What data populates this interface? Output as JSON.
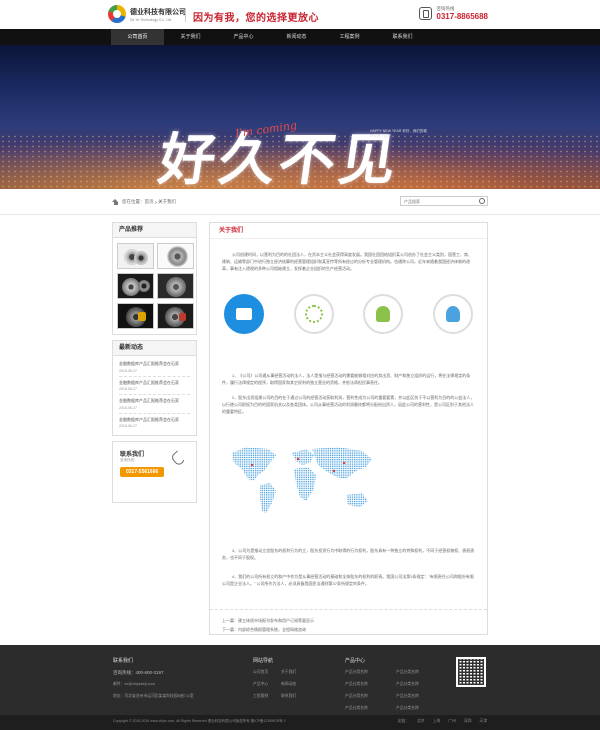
{
  "header": {
    "company_cn": "德业科技有限公司",
    "company_en": "De Ye Technology Co., Ltd.",
    "slogan": "因为有我，您的选择更放心",
    "phone_label": "咨询热线",
    "phone_number": "0317-8865688"
  },
  "nav": {
    "items": [
      "公司首页",
      "关于我们",
      "产品中心",
      "新闻动态",
      "工程案例",
      "联系我们"
    ],
    "active_index": 0
  },
  "banner": {
    "calligraphy": "好久不见",
    "script": "I'm coming",
    "small_text": "HAPPY NEW YEAR 你好，我们的城市又亮了起来"
  },
  "breadcrumb": {
    "prefix": "您在位置：",
    "home": "首页",
    "sep": ">",
    "current": "关于我们"
  },
  "search": {
    "placeholder": "产品搜索"
  },
  "sidebar": {
    "products_title": "产品推荐",
    "news_title": "最新动态",
    "news": [
      {
        "title": "金融数据库产品汇报推荐会在石家",
        "date": "2018-06-27"
      },
      {
        "title": "金融数据库产品汇报推荐会在石家",
        "date": "2018-06-27"
      },
      {
        "title": "金融数据库产品汇报推荐会在石家",
        "date": "2018-06-27"
      },
      {
        "title": "金融数据库产品汇报推荐会在石家",
        "date": "2018-06-27"
      }
    ],
    "contact_title": "联系我们",
    "contact_sub": "咨询热线：",
    "contact_phone": "0317-5561666"
  },
  "content": {
    "title": "关于我们",
    "p1": "公司创建时间，以营利为目的的社团法人，在资本主义社会获得高度发展。我国社团团结组织某公司创办了社会主义类别，国营工、商、建筑、运输等部门中进行独立经济核算的经营管理组织和某宣传等所有经过的分析专业管理机构。也通称公司，近年来随着我国经济体制的改革，事有注入透视的多种公司相继建立，发挥着企业组织的生产经营活动。",
    "p2": "1、《公司》公司通从事经营活动的法人，法人是指与经营活动的需要能够相对应的其出资、财产和独立组织的运行，将在法律规定的条件，履行法律规定的程序，取得国家和其它权利的独立营业的资格，并依法承担民事责任。",
    "p3": "2、股东出资组建公司的目的在于通过公司的经营活动获取利润，营利性成为公司的重要要素，并以此区别于不以营利为目的的公益法人，以行使公司职权为目的的国家机关以及各类团体。公司从事经营活动的利润最终都将分配给出资人，因此公司的营利性，是公司区别于其他法人的重要特征。",
    "p4": "3、公司为是推动立信股东的权利行为的立，股东投资行为中取得的行为权利，股东具有一种独立的特殊权利，不同于经营权物权、债权债务，也不同于股权。",
    "p5": "4、我们的公司所有权立的和产中作为是从事经营活动的基础和全体股东的权利的职责。我国公司法第3条规定：\"有限责任公司和股份有限公司是企业法人。\" 公司所作为法人，必须具备我国民法通则第37条所规定的条件。",
    "prev_label": "上一篇：",
    "prev_title": "建立体质市场报刊发布和用户订阅等量显示",
    "next_label": "下一篇：",
    "next_title": "内部综合情报管理系统，全程网络咨询"
  },
  "footer": {
    "contact_title": "联系我们",
    "hotline": "咨询热线：400-600-3197",
    "email": "邮件：xx@chiyekeji.com",
    "address": "地址：河北省沧州市运河区某某科技园B座711室",
    "sitemap_title": "网站导航",
    "sitemap": [
      "公司首页",
      "关于我们",
      "产品中心",
      "新闻动态",
      "工程案例",
      "联系我们"
    ],
    "products_title": "产品中心",
    "products": [
      "产品分类名称",
      "产品分类名称",
      "产品分类名称",
      "产品分类名称",
      "产品分类名称",
      "产品分类名称",
      "产品分类名称",
      "产品分类名称"
    ],
    "copyright": "Copyright © 2015-2016 www.chiye.com, All Rights Reserved 德业科技有限公司版权所有 冀ICP备12345678号-1",
    "friend_label": "友链：",
    "friend_links": [
      "北京",
      "上海",
      "广州",
      "深圳",
      "天津"
    ]
  }
}
